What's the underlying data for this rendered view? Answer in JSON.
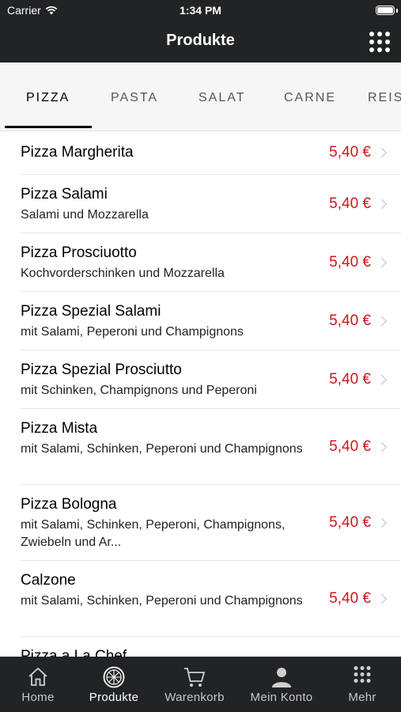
{
  "status_bar": {
    "carrier": "Carrier",
    "time": "1:34 PM"
  },
  "header": {
    "title": "Produkte"
  },
  "categories": [
    {
      "label": "PIZZA",
      "active": true
    },
    {
      "label": "PASTA",
      "active": false
    },
    {
      "label": "SALAT",
      "active": false
    },
    {
      "label": "CARNE",
      "active": false
    },
    {
      "label": "REIS",
      "active": false
    }
  ],
  "products": [
    {
      "name": "Pizza Margherita",
      "desc": "",
      "price": "5,40 €"
    },
    {
      "name": "Pizza Salami",
      "desc": "Salami und Mozzarella",
      "price": "5,40 €"
    },
    {
      "name": "Pizza Prosciuotto",
      "desc": "Kochvorderschinken und Mozzarella",
      "price": "5,40 €"
    },
    {
      "name": "Pizza Spezial Salami",
      "desc": "mit Salami, Peperoni und Champignons",
      "price": "5,40 €"
    },
    {
      "name": "Pizza Spezial Prosciutto",
      "desc": "mit Schinken, Champignons und Peperoni",
      "price": "5,40 €"
    },
    {
      "name": "Pizza Mista",
      "desc": "mit Salami, Schinken, Peperoni und Champignons",
      "price": "5,40 €"
    },
    {
      "name": "Pizza Bologna",
      "desc": "mit Salami, Schinken, Peperoni, Champignons, Zwiebeln und Ar...",
      "price": "5,40 €"
    },
    {
      "name": "Calzone",
      "desc": "mit Salami, Schinken, Peperoni und Champignons",
      "price": "5,40 €"
    },
    {
      "name": "Pizza a La Chef",
      "desc": "",
      "price": ""
    }
  ],
  "tabbar": [
    {
      "label": "Home",
      "icon": "home-icon",
      "active": false
    },
    {
      "label": "Produkte",
      "icon": "pizza-icon",
      "active": true
    },
    {
      "label": "Warenkorb",
      "icon": "cart-icon",
      "active": false
    },
    {
      "label": "Mein Konto",
      "icon": "user-icon",
      "active": false
    },
    {
      "label": "Mehr",
      "icon": "grid-icon",
      "active": false
    }
  ],
  "colors": {
    "bar": "#222325",
    "price": "#d0161b"
  }
}
